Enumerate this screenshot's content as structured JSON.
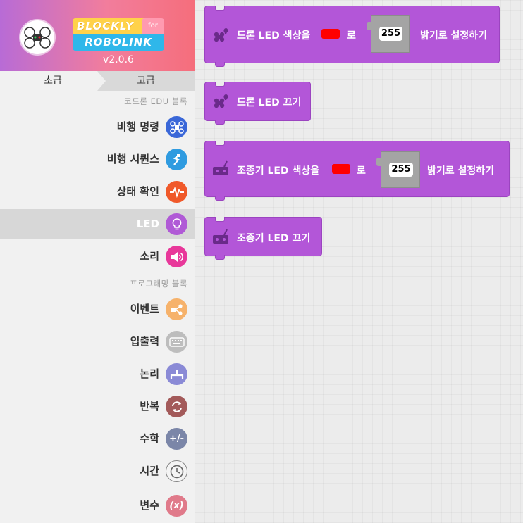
{
  "brand": {
    "logo_top": "BLOCKLY",
    "logo_for": "for",
    "logo_bottom": "ROBOLINK",
    "version": "v2.0.6"
  },
  "tabs": {
    "basic": "초급",
    "advanced": "고급"
  },
  "sections": {
    "edu": "코드론 EDU 블록",
    "programming": "프로그래밍 블록"
  },
  "categories": [
    {
      "label": "비행 명령",
      "icon": "drone-flight-icon",
      "color": "#3a67d8"
    },
    {
      "label": "비행 시퀀스",
      "icon": "sequence-arrow-icon",
      "color": "#2f9be0"
    },
    {
      "label": "상태 확인",
      "icon": "pulse-icon",
      "color": "#f0592a"
    },
    {
      "label": "LED",
      "icon": "lightbulb-icon",
      "color": "#b05ad6",
      "selected": true
    },
    {
      "label": "소리",
      "icon": "speaker-icon",
      "color": "#e8389a"
    },
    {
      "label": "이벤트",
      "icon": "share-icon",
      "color": "#f6b26b"
    },
    {
      "label": "입출력",
      "icon": "keyboard-icon",
      "color": "#bdbdbd"
    },
    {
      "label": "논리",
      "icon": "logic-icon",
      "color": "#8a8ad6"
    },
    {
      "label": "반복",
      "icon": "loop-icon",
      "color": "#a35a5a"
    },
    {
      "label": "수학",
      "icon": "plus-minus-icon",
      "color": "#7b86a8"
    },
    {
      "label": "시간",
      "icon": "clock-icon",
      "color": "#f0f0f0"
    },
    {
      "label": "변수",
      "icon": "variable-icon",
      "color": "#e07a8a"
    }
  ],
  "blocks": {
    "drone_led_color": {
      "prefix": "드론 LED 색상을",
      "mid": "로",
      "value": "255",
      "suffix": "밝기로 설정하기"
    },
    "drone_led_off": {
      "text": "드론 LED 끄기"
    },
    "controller_led_color": {
      "prefix": "조종기 LED 색상을",
      "mid": "로",
      "value": "255",
      "suffix": "밝기로 설정하기"
    },
    "controller_led_off": {
      "text": "조종기 LED 끄기"
    }
  },
  "colors": {
    "block": "#b356d8",
    "swatch": "#ff0000",
    "selected_row": "#d7d7d7"
  }
}
